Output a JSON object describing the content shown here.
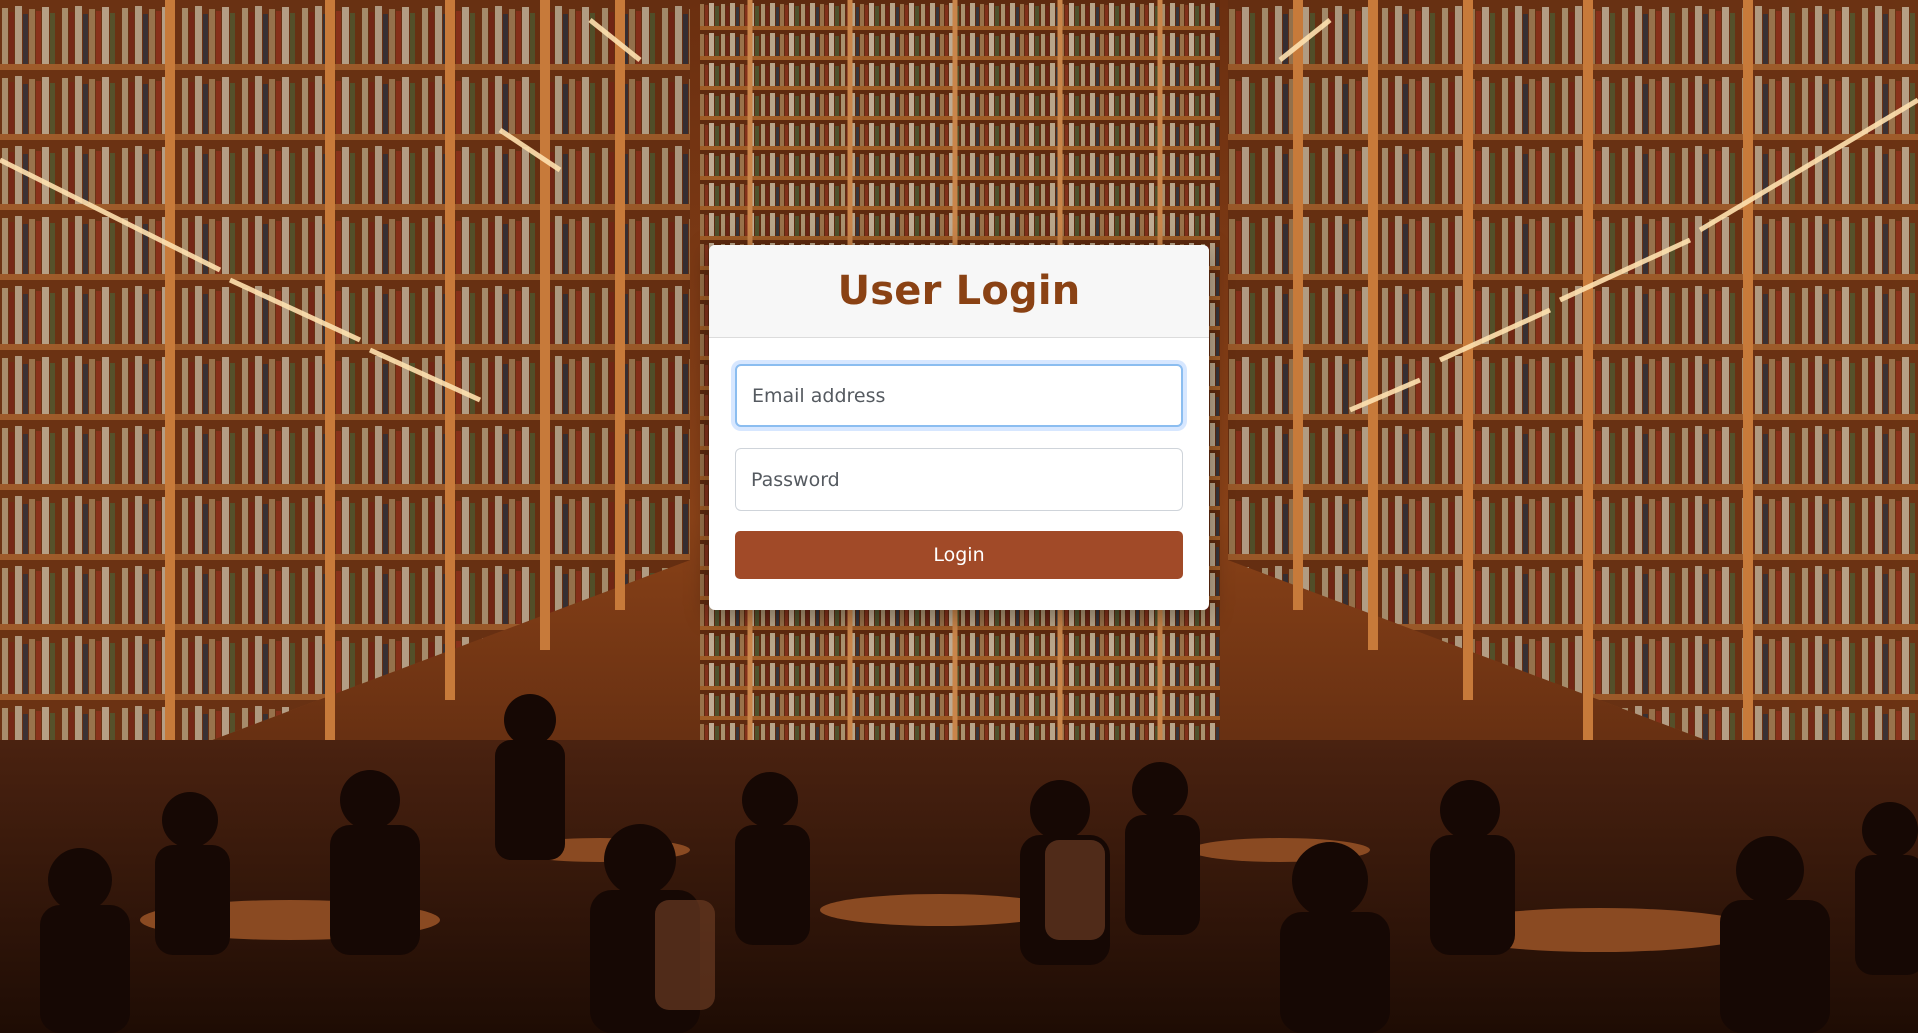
{
  "background": {
    "scene": "library-reading-room",
    "colors": {
      "shelf_wood": "#b0632a",
      "shelf_dark": "#5a2a10",
      "light_strip": "#ffd9a0",
      "floor_shadow": "#2a1206"
    }
  },
  "login": {
    "title": "User Login",
    "email_placeholder": "Email address",
    "password_placeholder": "Password",
    "submit_label": "Login",
    "colors": {
      "title": "#8a4214",
      "button": "#a14a28",
      "focus_ring": "#8bbdf0"
    }
  }
}
